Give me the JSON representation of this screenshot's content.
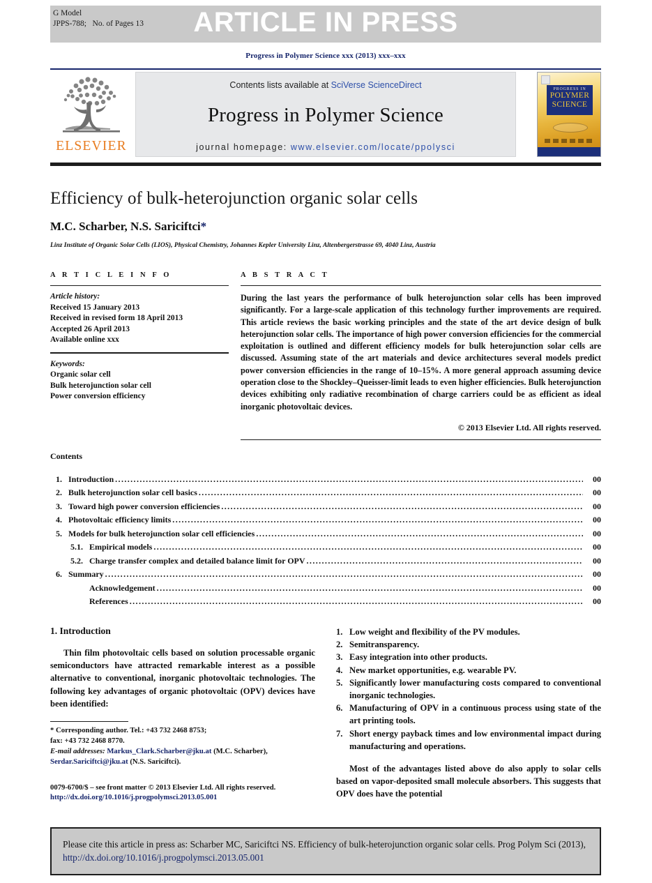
{
  "header": {
    "gmodel_line1": "G Model",
    "gmodel_line2": "JPPS-788;   No. of Pages 13",
    "press_banner": "ARTICLE IN PRESS",
    "running_head": "Progress in Polymer Science xxx (2013) xxx–xxx"
  },
  "masthead": {
    "contents_prefix": "Contents lists available at ",
    "sciencedirect": "SciVerse ScienceDirect",
    "journal_name": "Progress in Polymer Science",
    "homepage_prefix": "journal homepage: ",
    "homepage_url": "www.elsevier.com/locate/ppolysci",
    "elsevier_wordmark": "ELSEVIER",
    "cover": {
      "line_top": "PROGRESS IN",
      "line_main_1": "POLYMER",
      "line_main_2": "SCIENCE"
    }
  },
  "title_block": {
    "title": "Efficiency of bulk-heterojunction organic solar cells",
    "authors": "M.C. Scharber, N.S. Sariciftci",
    "corresponding_marker": "*",
    "affiliation": "Linz Institute of Organic Solar Cells (LIOS), Physical Chemistry, Johannes Kepler University Linz, Altenbergerstrasse 69, 4040 Linz, Austria"
  },
  "article_info": {
    "heading": "A R T I C L E   I N F O",
    "history_label": "Article history:",
    "history": [
      "Received 15 January 2013",
      "Received in revised form 18 April 2013",
      "Accepted 26 April 2013",
      "Available online xxx"
    ],
    "keywords_label": "Keywords:",
    "keywords": [
      "Organic solar cell",
      "Bulk heterojunction solar cell",
      "Power conversion efficiency"
    ]
  },
  "abstract": {
    "heading": "A B S T R A C T",
    "text": "During the last years the performance of bulk heterojunction solar cells has been improved significantly. For a large-scale application of this technology further improvements are required. This article reviews the basic working principles and the state of the art device design of bulk heterojunction solar cells. The importance of high power conversion efficiencies for the commercial exploitation is outlined and different efficiency models for bulk heterojunction solar cells are discussed. Assuming state of the art materials and device architectures several models predict power conversion efficiencies in the range of 10–15%. A more general approach assuming device operation close to the Shockley–Queisser-limit leads to even higher efficiencies. Bulk heterojunction devices exhibiting only radiative recombination of charge carriers could be as efficient as ideal inorganic photovoltaic devices.",
    "copyright": "© 2013 Elsevier Ltd. All rights reserved."
  },
  "contents": {
    "heading": "Contents",
    "items": [
      {
        "num": "1.",
        "label": "Introduction",
        "page": "00",
        "sub": false
      },
      {
        "num": "2.",
        "label": "Bulk heterojunction solar cell basics",
        "page": "00",
        "sub": false
      },
      {
        "num": "3.",
        "label": "Toward high power conversion efficiencies",
        "page": "00",
        "sub": false
      },
      {
        "num": "4.",
        "label": "Photovoltaic efficiency limits",
        "page": "00",
        "sub": false
      },
      {
        "num": "5.",
        "label": "Models for bulk heterojunction solar cell efficiencies",
        "page": "00",
        "sub": false
      },
      {
        "num": "5.1.",
        "label": "Empirical models",
        "page": "00",
        "sub": true
      },
      {
        "num": "5.2.",
        "label": "Charge transfer complex and detailed balance limit for OPV",
        "page": "00",
        "sub": true
      },
      {
        "num": "6.",
        "label": "Summary",
        "page": "00",
        "sub": false
      },
      {
        "num": "",
        "label": "Acknowledgement",
        "page": "00",
        "sub": true
      },
      {
        "num": "",
        "label": "References",
        "page": "00",
        "sub": true
      }
    ]
  },
  "introduction": {
    "heading": "1.  Introduction",
    "paragraph": "Thin film photovoltaic cells based on solution processable organic semiconductors have attracted remarkable interest as a possible alternative to conventional, inorganic photovoltaic technologies. The following key advantages of organic photovoltaic (OPV) devices have been identified:"
  },
  "advantages": {
    "items": [
      {
        "num": "1.",
        "text": "Low weight and flexibility of the PV modules."
      },
      {
        "num": "2.",
        "text": "Semitransparency."
      },
      {
        "num": "3.",
        "text": "Easy integration into other products."
      },
      {
        "num": "4.",
        "text": "New market opportunities, e.g. wearable PV."
      },
      {
        "num": "5.",
        "text": "Significantly lower manufacturing costs compared to conventional inorganic technologies."
      },
      {
        "num": "6.",
        "text": "Manufacturing of OPV in a continuous process using state of the art printing tools."
      },
      {
        "num": "7.",
        "text": "Short energy payback times and low environmental impact during manufacturing and operations."
      }
    ],
    "closing_paragraph": "Most of the advantages listed above do also apply to solar cells based on vapor-deposited small molecule absorbers. This suggests that OPV does have the potential"
  },
  "footnote": {
    "corresponding": "*  Corresponding author. Tel.: +43 732 2468 8753;",
    "fax": "fax: +43 732 2468 8770.",
    "email_label": "E-mail addresses:",
    "email1": "Markus_Clark.Scharber@jku.at",
    "email1_owner": "(M.C. Scharber),",
    "email2": "Serdar.Sariciftci@jku.at",
    "email2_owner": "(N.S. Sariciftci).",
    "frontmatter": "0079-6700/$ – see front matter © 2013 Elsevier Ltd. All rights reserved.",
    "doi": "http://dx.doi.org/10.1016/j.progpolymsci.2013.05.001"
  },
  "cite_box": {
    "text_before_link": "Please cite this article in press as: Scharber MC, Sariciftci NS. Efficiency of bulk-heterojunction organic solar cells. Prog Polym Sci (2013), ",
    "link": "http://dx.doi.org/10.1016/j.progpolymsci.2013.05.001"
  },
  "colors": {
    "navy": "#16256b",
    "link_blue": "#2c4ea8",
    "elsevier_orange": "#e87b1e",
    "band_gray": "#c9c9c9",
    "masthead_gray": "#e7e8ea"
  }
}
